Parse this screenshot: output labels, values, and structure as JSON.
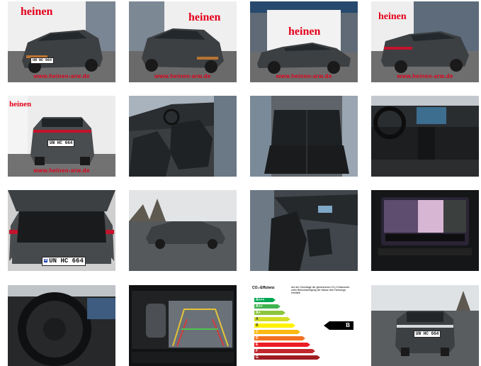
{
  "watermark": "www.heinen-arw.de",
  "dealer_sign": "heinen",
  "dealer_sign_short": "heinen",
  "plate_short": "UN HC 664",
  "plate_text": "UN HC 664",
  "plate_eu": "D",
  "energy": {
    "title": "CO₂-Effizienz",
    "note": "Auf der Grundlage der gemessenen CO₂-Emissionen unter Berücksichtigung der Masse des Fahrzeugs ermittelt.",
    "classes": [
      "A+++",
      "A++",
      "A+",
      "A",
      "B",
      "C",
      "D",
      "E",
      "F",
      "G"
    ],
    "rating": "B"
  },
  "colors": {
    "brand_red": "#e3001b",
    "car_grey": "#3d4043",
    "copper": "#b87333"
  },
  "photos": [
    {
      "id": "front-left-exterior"
    },
    {
      "id": "front-right-exterior"
    },
    {
      "id": "side-profile-exterior"
    },
    {
      "id": "rear-left-exterior"
    },
    {
      "id": "rear-exterior"
    },
    {
      "id": "front-seats-interior"
    },
    {
      "id": "rear-seats-interior"
    },
    {
      "id": "dashboard-interior"
    },
    {
      "id": "trunk-open"
    },
    {
      "id": "side-parking-lot"
    },
    {
      "id": "passenger-seat-interior"
    },
    {
      "id": "infotainment-screen"
    },
    {
      "id": "steering-wheel"
    },
    {
      "id": "rear-camera-display"
    },
    {
      "id": "energy-label"
    },
    {
      "id": "front-parking-lot"
    }
  ]
}
